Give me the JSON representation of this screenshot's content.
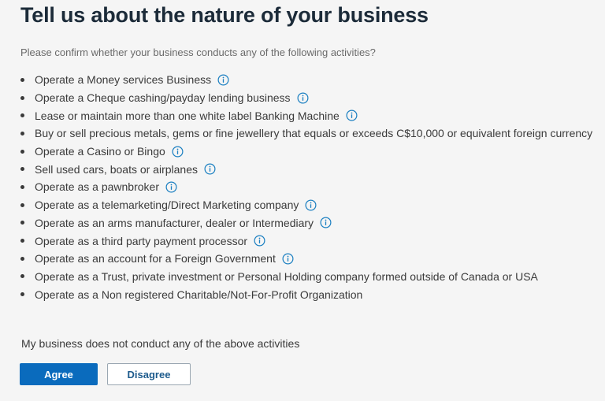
{
  "header": {
    "title": "Tell us about the nature of your business"
  },
  "intro": {
    "text": "Please confirm whether your business conducts any of the following activities?"
  },
  "activities": [
    {
      "label": "Operate a Money services Business",
      "info": true
    },
    {
      "label": "Operate a Cheque cashing/payday lending business",
      "info": true
    },
    {
      "label": "Lease or maintain more than one white label Banking Machine",
      "info": true
    },
    {
      "label": "Buy or sell precious metals, gems or fine jewellery that equals or exceeds C$10,000 or equivalent foreign currency",
      "info": false
    },
    {
      "label": "Operate a Casino or Bingo",
      "info": true
    },
    {
      "label": "Sell used cars, boats or airplanes",
      "info": true
    },
    {
      "label": "Operate as a pawnbroker",
      "info": true
    },
    {
      "label": "Operate as a telemarketing/Direct Marketing company",
      "info": true
    },
    {
      "label": "Operate as an arms manufacturer, dealer or Intermediary",
      "info": true
    },
    {
      "label": "Operate as a third party payment processor",
      "info": true
    },
    {
      "label": "Operate as an account for a Foreign Government",
      "info": true
    },
    {
      "label": "Operate as a Trust, private investment or Personal Holding company formed outside of Canada or USA",
      "info": false
    },
    {
      "label": "Operate as a Non registered Charitable/Not-For-Profit Organization",
      "info": false
    }
  ],
  "icons": {
    "info": "info-circle-icon",
    "bullet": "bullet-dot"
  },
  "footer": {
    "disclaimer": "My business does not conduct any of the above activities",
    "agree_label": "Agree",
    "disagree_label": "Disagree"
  },
  "colors": {
    "primary": "#0a6bbd",
    "title": "#1c2b39",
    "info_icon": "#1a7fc1",
    "background": "#f5f5f5"
  }
}
